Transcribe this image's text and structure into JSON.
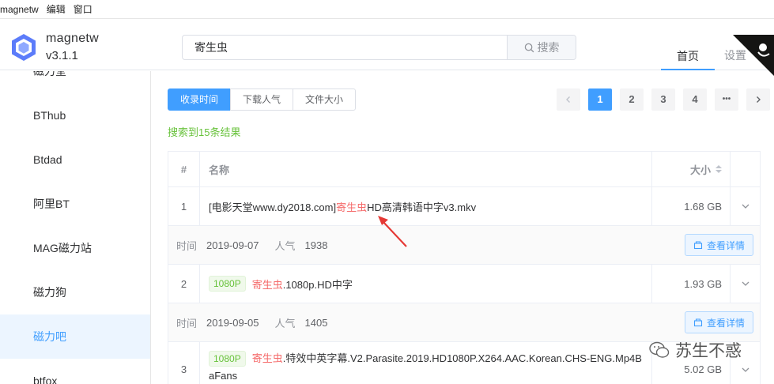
{
  "menubar": {
    "items": [
      "magnetw",
      "编辑",
      "窗口"
    ]
  },
  "app": {
    "name": "magnetw",
    "version": "v3.1.1"
  },
  "search": {
    "value": "寄生虫",
    "button_label": "搜索"
  },
  "nav": {
    "home": "首页",
    "settings": "设置"
  },
  "sidebar": {
    "items": [
      {
        "label": "磁力堂",
        "active": false
      },
      {
        "label": "BThub",
        "active": false
      },
      {
        "label": "Btdad",
        "active": false
      },
      {
        "label": "阿里BT",
        "active": false
      },
      {
        "label": "MAG磁力站",
        "active": false
      },
      {
        "label": "磁力狗",
        "active": false
      },
      {
        "label": "磁力吧",
        "active": true
      },
      {
        "label": "btfox",
        "active": false
      }
    ]
  },
  "sort": {
    "options": [
      "收录时间",
      "下载人气",
      "文件大小"
    ],
    "active_index": 0
  },
  "pager": {
    "pages": [
      "1",
      "2",
      "3",
      "4"
    ],
    "more": "•••",
    "current": "1"
  },
  "result_count": "搜索到15条结果",
  "table": {
    "headers": {
      "num": "#",
      "name": "名称",
      "size": "大小"
    },
    "rows": [
      {
        "num": "1",
        "tag": "",
        "name_prefix": "[电影天堂www.dy2018.com]",
        "keyword": "寄生虫",
        "name_suffix": "HD高清韩语中字v3.mkv",
        "size": "1.68 GB",
        "time_label": "时间",
        "time": "2019-09-07",
        "pop_label": "人气",
        "pop": "1938",
        "detail_label": "查看详情"
      },
      {
        "num": "2",
        "tag": "1080P",
        "name_prefix": "",
        "keyword": "寄生虫",
        "name_suffix": ".1080p.HD中字",
        "size": "1.93 GB",
        "time_label": "时间",
        "time": "2019-09-05",
        "pop_label": "人气",
        "pop": "1405",
        "detail_label": "查看详情"
      },
      {
        "num": "3",
        "tag": "1080P",
        "name_prefix": "",
        "keyword": "寄生虫",
        "name_suffix": ".特效中英字幕.V2.Parasite.2019.HD1080P.X264.AAC.Korean.CHS-ENG.Mp4BaFans",
        "size": "5.02 GB"
      }
    ]
  },
  "watermark": "苏生不惑",
  "colors": {
    "primary": "#409eff",
    "keyword": "#f56c6c",
    "success": "#67c23a",
    "annotation": "#e53935"
  }
}
